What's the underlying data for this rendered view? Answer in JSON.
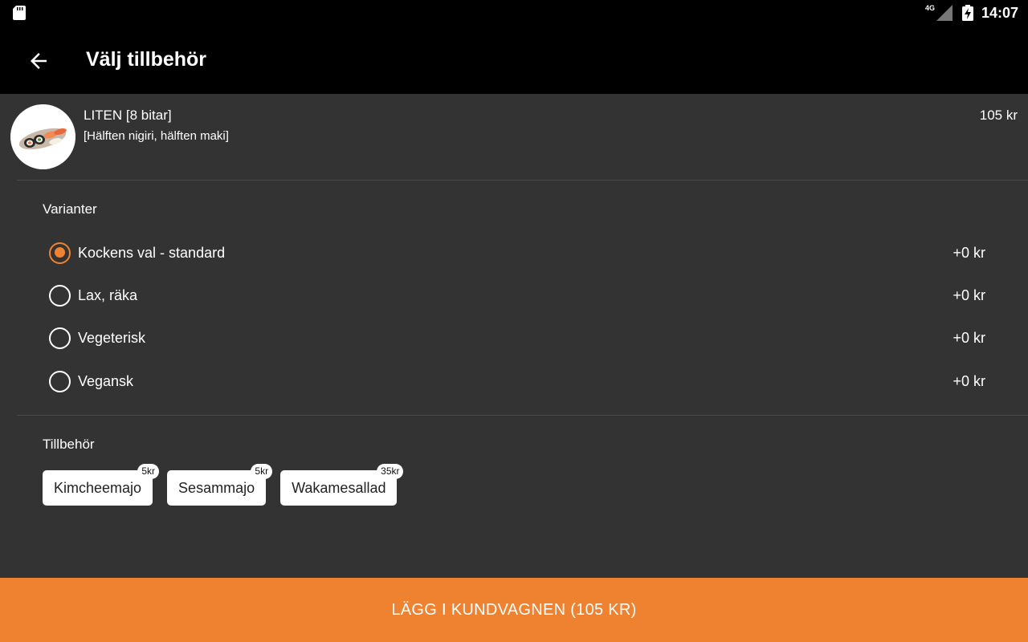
{
  "status_bar": {
    "network": "4G",
    "time": "14:07"
  },
  "app_bar": {
    "title": "Välj tillbehör"
  },
  "product": {
    "name": "LITEN [8 bitar]",
    "description": "[Hälften nigiri, hälften maki]",
    "price": "105 kr"
  },
  "variants": {
    "label": "Varianter",
    "items": [
      {
        "label": "Kockens val - standard",
        "price": "+0 kr",
        "selected": true
      },
      {
        "label": "Lax, räka",
        "price": "+0 kr",
        "selected": false
      },
      {
        "label": "Vegeterisk",
        "price": "+0 kr",
        "selected": false
      },
      {
        "label": "Vegansk",
        "price": "+0 kr",
        "selected": false
      }
    ]
  },
  "accessories": {
    "label": "Tillbehör",
    "items": [
      {
        "label": "Kimcheemajo",
        "price": "5kr"
      },
      {
        "label": "Sesammajo",
        "price": "5kr"
      },
      {
        "label": "Wakamesallad",
        "price": "35kr"
      }
    ]
  },
  "cart_button": {
    "label": "LÄGG I KUNDVAGNEN (105 KR)"
  },
  "colors": {
    "accent": "#ee8231",
    "background": "#333333",
    "app_bar": "#000000"
  }
}
